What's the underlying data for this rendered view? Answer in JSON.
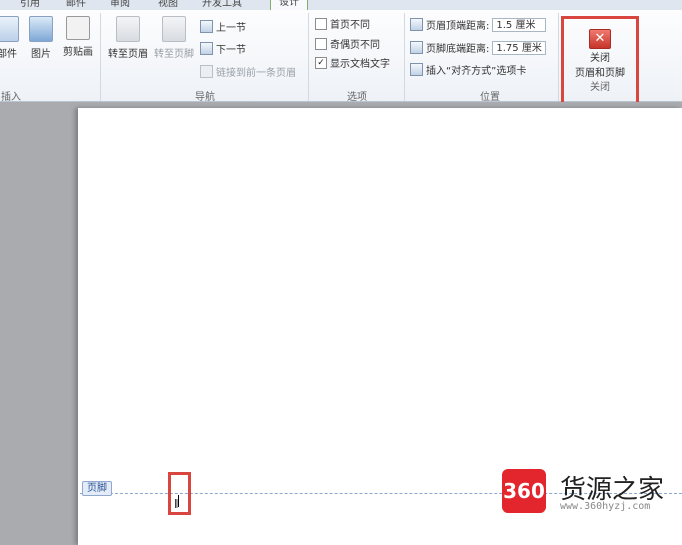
{
  "tabs": [
    {
      "label": "引用"
    },
    {
      "label": "邮件"
    },
    {
      "label": "审阅"
    },
    {
      "label": "视图"
    },
    {
      "label": "开发工具"
    },
    {
      "label": "设计"
    }
  ],
  "insert_group": {
    "label": "插入",
    "parts_label": "部件",
    "picture_label": "图片",
    "clipart_label": "剪贴画"
  },
  "nav_group": {
    "label": "导航",
    "goto_header": "转至页眉",
    "goto_footer": "转至页脚",
    "prev_section": "上一节",
    "next_section": "下一节",
    "link_previous": "链接到前一条页眉"
  },
  "options_group": {
    "label": "选项",
    "first_page_diff": "首页不同",
    "odd_even_diff": "奇偶页不同",
    "show_doc_text": "显示文档文字"
  },
  "position_group": {
    "label": "位置",
    "header_top_label": "页眉顶端距离:",
    "header_top_value": "1.5 厘米",
    "footer_bottom_label": "页脚底端距离:",
    "footer_bottom_value": "1.75 厘米",
    "insert_align_tab": "插入“对齐方式”选项卡"
  },
  "close_group": {
    "label": "关闭",
    "button_line1": "关闭",
    "button_line2": "页眉和页脚"
  },
  "document": {
    "footer_tag": "页脚"
  },
  "watermark": {
    "logo": "360",
    "title": "货源之家",
    "url": "www.360hyzj.com"
  },
  "colors": {
    "highlight": "#d9463f",
    "close_icon": "#d33a30",
    "watermark_red": "#e3262e"
  }
}
